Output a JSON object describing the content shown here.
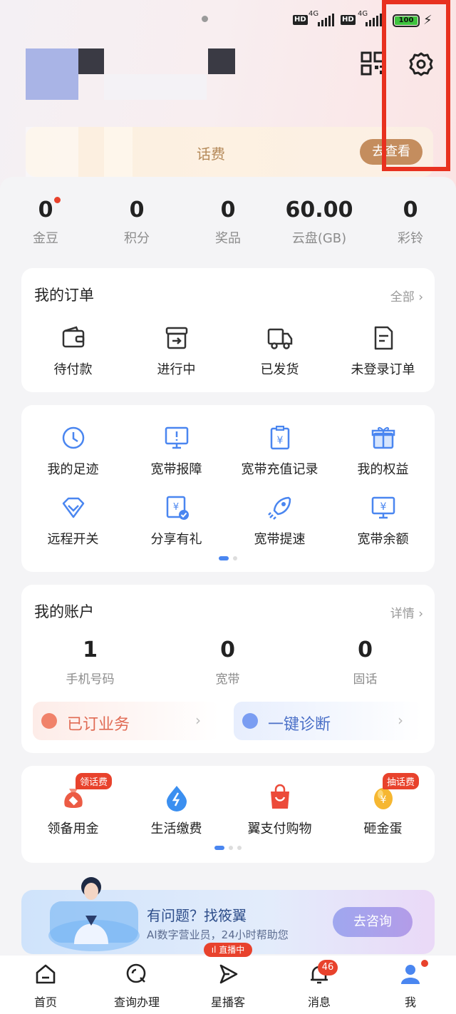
{
  "status_bar": {
    "hd1": "HD",
    "net1": "4G",
    "hd2": "HD",
    "net2": "4G",
    "battery": "100",
    "icons": [
      "notification-dot",
      "signal-icon",
      "battery-icon",
      "charging-icon"
    ]
  },
  "header": {
    "icons": [
      "qr-code-icon",
      "settings-gear-icon"
    ]
  },
  "promo": {
    "text": "话费",
    "button": "去查看"
  },
  "stats": [
    {
      "value": "0",
      "label": "金豆"
    },
    {
      "value": "0",
      "label": "积分"
    },
    {
      "value": "0",
      "label": "奖品"
    },
    {
      "value": "60.00",
      "label": "云盘(GB)"
    },
    {
      "value": "0",
      "label": "彩铃"
    }
  ],
  "orders": {
    "title": "我的订单",
    "more": "全部",
    "items": [
      {
        "label": "待付款",
        "icon": "wallet-icon"
      },
      {
        "label": "进行中",
        "icon": "inbox-icon"
      },
      {
        "label": "已发货",
        "icon": "truck-icon"
      },
      {
        "label": "未登录订单",
        "icon": "document-icon"
      }
    ]
  },
  "services": {
    "items": [
      {
        "label": "我的足迹",
        "icon": "clock-icon"
      },
      {
        "label": "宽带报障",
        "icon": "monitor-alert-icon"
      },
      {
        "label": "宽带充值记录",
        "icon": "recharge-clipboard-icon"
      },
      {
        "label": "我的权益",
        "icon": "gift-icon"
      },
      {
        "label": "远程开关",
        "icon": "diamond-icon"
      },
      {
        "label": "分享有礼",
        "icon": "share-check-icon"
      },
      {
        "label": "宽带提速",
        "icon": "rocket-icon"
      },
      {
        "label": "宽带余额",
        "icon": "monitor-yen-icon"
      }
    ]
  },
  "account": {
    "title": "我的账户",
    "more": "详情",
    "items": [
      {
        "value": "1",
        "label": "手机号码"
      },
      {
        "value": "0",
        "label": "宽带"
      },
      {
        "value": "0",
        "label": "固话"
      }
    ],
    "subscribed": "已订业务",
    "diagnose": "一键诊断"
  },
  "perks": {
    "items": [
      {
        "label": "领备用金",
        "icon": "money-bag-icon",
        "tag": "领话费"
      },
      {
        "label": "生活缴费",
        "icon": "water-drop-icon",
        "tag": ""
      },
      {
        "label": "翼支付购物",
        "icon": "shopping-bag-icon",
        "tag": ""
      },
      {
        "label": "砸金蛋",
        "icon": "golden-egg-icon",
        "tag": "抽话费"
      }
    ]
  },
  "ai": {
    "title": "有问题？找筱翼",
    "subtitle": "AI数字营业员，24小时帮助您",
    "button": "去咨询"
  },
  "tabs": [
    {
      "label": "首页",
      "icon": "home-icon"
    },
    {
      "label": "查询办理",
      "icon": "search-circle-icon"
    },
    {
      "label": "星播客",
      "icon": "play-icon"
    },
    {
      "label": "消息",
      "icon": "bell-icon"
    },
    {
      "label": "我",
      "icon": "user-icon"
    }
  ],
  "live_tag": "直播中",
  "message_count": "46",
  "colors": {
    "accent": "#4a86f0",
    "alert": "#e8422c",
    "highlight_box": "#e8311f",
    "promo_button": "#c48d5e"
  }
}
